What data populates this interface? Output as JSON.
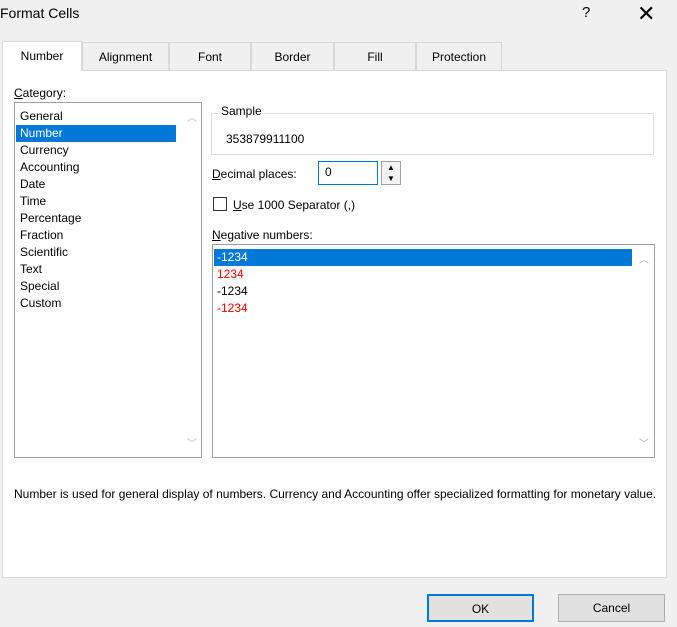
{
  "window": {
    "title": "Format Cells",
    "help_label": "?",
    "close_label": "✕"
  },
  "tabs": [
    {
      "label": "Number",
      "active": true
    },
    {
      "label": "Alignment"
    },
    {
      "label": "Font"
    },
    {
      "label": "Border"
    },
    {
      "label": "Fill"
    },
    {
      "label": "Protection"
    }
  ],
  "category": {
    "label_mnemonic": "C",
    "label_rest": "ategory:",
    "selected": "Number",
    "items": [
      "General",
      "Number",
      "Currency",
      "Accounting",
      "Date",
      "Time",
      "Percentage",
      "Fraction",
      "Scientific",
      "Text",
      "Special",
      "Custom"
    ]
  },
  "sample": {
    "legend": "Sample",
    "value": "353879911100"
  },
  "decimal_places": {
    "label_mnemonic": "D",
    "label_rest": "ecimal places:",
    "value": "0"
  },
  "separator": {
    "label_mnemonic": "U",
    "label_rest": "se 1000 Separator (,)",
    "checked": false
  },
  "negative_numbers": {
    "label_mnemonic": "N",
    "label_rest": "egative numbers:",
    "items": [
      {
        "text": "-1234",
        "color": "#ffffff",
        "selected": true
      },
      {
        "text": "1234",
        "color": "#ff0000"
      },
      {
        "text": "-1234",
        "color": "#000000"
      },
      {
        "text": "-1234",
        "color": "#ff0000"
      }
    ]
  },
  "description": "Number is used for general display of numbers.  Currency and Accounting offer specialized formatting for monetary value.",
  "buttons": {
    "ok": "OK",
    "cancel": "Cancel"
  },
  "colors": {
    "accent": "#0078d7",
    "negative_red": "#ff0000"
  }
}
